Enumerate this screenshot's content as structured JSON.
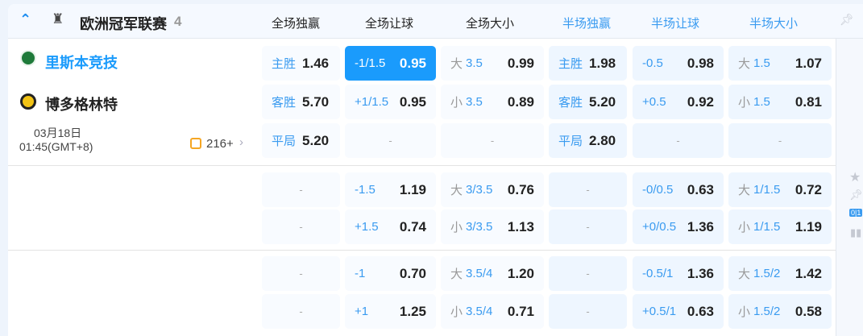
{
  "league": {
    "name": "欧洲冠军联赛",
    "count": "4",
    "icon": "trophy-icon",
    "collapse_icon": "chevron-up-icon"
  },
  "columns": [
    "全场独赢",
    "全场让球",
    "全场大小",
    "半场独赢",
    "半场让球",
    "半场大小"
  ],
  "match": {
    "home": "里斯本竞技",
    "away": "博多格林特",
    "date": "03月18日",
    "time": "01:45(GMT+8)",
    "more": "216+"
  },
  "colors": {
    "accent": "#1a9bfc",
    "label": "#3a9bf0"
  },
  "sections": [
    {
      "rows": [
        [
          [
            "主胜",
            "1.46"
          ],
          [
            "-1/1.5",
            "0.95",
            "sel"
          ],
          [
            "大",
            "3.5",
            "0.99"
          ],
          [
            "主胜",
            "1.98"
          ],
          [
            "-0.5",
            "0.98"
          ],
          [
            "大",
            "1.5",
            "1.07"
          ]
        ],
        [
          [
            "客胜",
            "5.70"
          ],
          [
            "+1/1.5",
            "0.95"
          ],
          [
            "小",
            "3.5",
            "0.89"
          ],
          [
            "客胜",
            "5.20"
          ],
          [
            "+0.5",
            "0.92"
          ],
          [
            "小",
            "1.5",
            "0.81"
          ]
        ],
        [
          [
            "平局",
            "5.20"
          ],
          [
            "-"
          ],
          [
            "-"
          ],
          [
            "平局",
            "2.80"
          ],
          [
            "-"
          ],
          [
            "-"
          ]
        ]
      ]
    },
    {
      "rows": [
        [
          [
            "-"
          ],
          [
            "-1.5",
            "1.19"
          ],
          [
            "大",
            "3/3.5",
            "0.76"
          ],
          [
            "-"
          ],
          [
            "-0/0.5",
            "0.63"
          ],
          [
            "大",
            "1/1.5",
            "0.72"
          ]
        ],
        [
          [
            "-"
          ],
          [
            "+1.5",
            "0.74"
          ],
          [
            "小",
            "3/3.5",
            "1.13"
          ],
          [
            "-"
          ],
          [
            "+0/0.5",
            "1.36"
          ],
          [
            "小",
            "1/1.5",
            "1.19"
          ]
        ]
      ]
    },
    {
      "rows": [
        [
          [
            "-"
          ],
          [
            "-1",
            "0.70"
          ],
          [
            "大",
            "3.5/4",
            "1.20"
          ],
          [
            "-"
          ],
          [
            "-0.5/1",
            "1.36"
          ],
          [
            "大",
            "1.5/2",
            "1.42"
          ]
        ],
        [
          [
            "-"
          ],
          [
            "+1",
            "1.25"
          ],
          [
            "小",
            "3.5/4",
            "0.71"
          ],
          [
            "-"
          ],
          [
            "+0.5/1",
            "0.63"
          ],
          [
            "小",
            "1.5/2",
            "0.58"
          ]
        ]
      ]
    }
  ],
  "side": {
    "score_badge": "0|1"
  }
}
